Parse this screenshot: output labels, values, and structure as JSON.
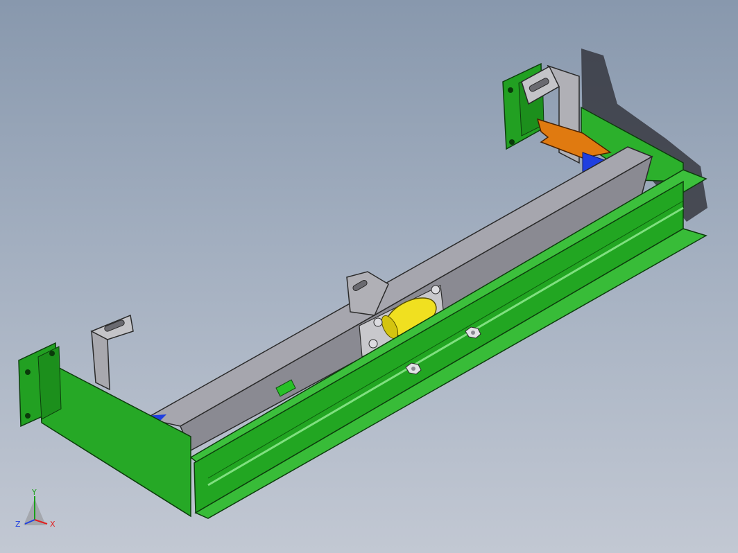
{
  "viewport": {
    "background_top": "#8898ad",
    "background_bottom": "#c2c8d3"
  },
  "model": {
    "parts": [
      {
        "name": "frame",
        "color": "#1fa01f"
      },
      {
        "name": "rail",
        "color": "#9a9aa3"
      },
      {
        "name": "bracket",
        "color": "#a8a8ae"
      },
      {
        "name": "clamp-plate",
        "color": "#e07a10"
      },
      {
        "name": "roller",
        "color": "#f0e020"
      },
      {
        "name": "wedge",
        "color": "#1f3fe0"
      },
      {
        "name": "shaft",
        "color": "#28c028"
      },
      {
        "name": "nut",
        "color": "#d4d4d8"
      }
    ]
  },
  "triad": {
    "y_label": "Y",
    "z_label": "Z",
    "x_label": "X",
    "y_color": "#1aa01a",
    "z_color": "#2040e0",
    "x_color": "#e02020"
  }
}
